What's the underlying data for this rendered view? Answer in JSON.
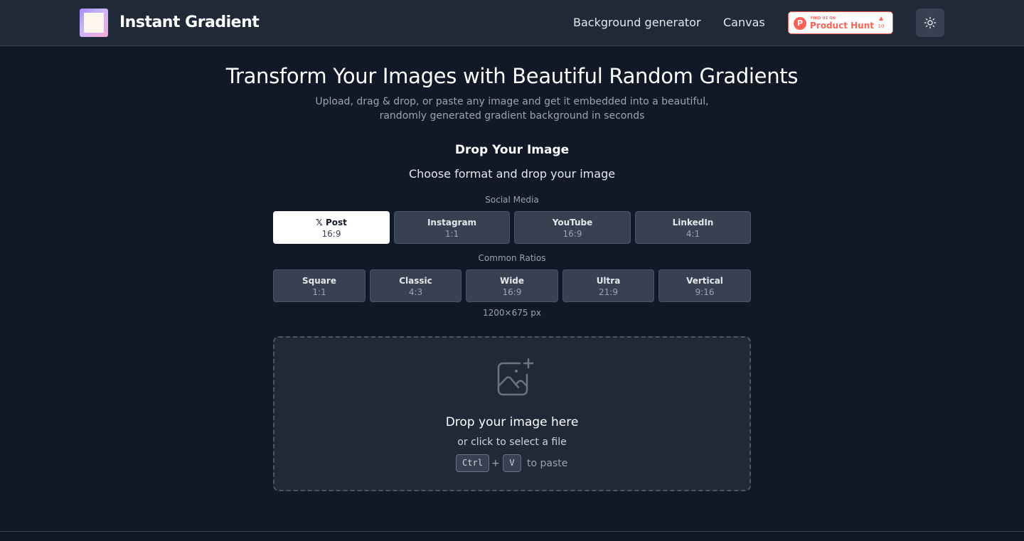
{
  "header": {
    "app_title": "Instant Gradient",
    "nav": [
      {
        "label": "Background generator"
      },
      {
        "label": "Canvas"
      }
    ],
    "product_hunt": {
      "find_text": "FIND US ON",
      "name": "Product Hunt",
      "count": "10"
    },
    "theme_icon": "sun-icon"
  },
  "hero": {
    "title": "Transform Your Images with Beautiful Random Gradients",
    "subtitle_line1": "Upload, drag & drop, or paste any image and get it embedded into a beautiful,",
    "subtitle_line2": "randomly generated gradient background in seconds"
  },
  "format_section": {
    "title": "Drop Your Image",
    "subtitle": "Choose format and drop your image",
    "social_label": "Social Media",
    "social": [
      {
        "name": "𝕏 Post",
        "ratio": "16:9",
        "active": true
      },
      {
        "name": "Instagram",
        "ratio": "1:1",
        "active": false
      },
      {
        "name": "YouTube",
        "ratio": "16:9",
        "active": false
      },
      {
        "name": "LinkedIn",
        "ratio": "4:1",
        "active": false
      }
    ],
    "common_label": "Common Ratios",
    "common": [
      {
        "name": "Square",
        "ratio": "1:1"
      },
      {
        "name": "Classic",
        "ratio": "4:3"
      },
      {
        "name": "Wide",
        "ratio": "16:9"
      },
      {
        "name": "Ultra",
        "ratio": "21:9"
      },
      {
        "name": "Vertical",
        "ratio": "9:16"
      }
    ],
    "dimensions": "1200×675 px"
  },
  "dropzone": {
    "icon": "image-plus-icon",
    "title": "Drop your image here",
    "subtitle": "or click to select a file",
    "key_ctrl": "Ctrl",
    "plus": "+",
    "key_v": "V",
    "paste_text": "to paste"
  },
  "colors": {
    "background": "#111827",
    "header": "#1f2937",
    "accent_product_hunt": "#ff6154"
  }
}
